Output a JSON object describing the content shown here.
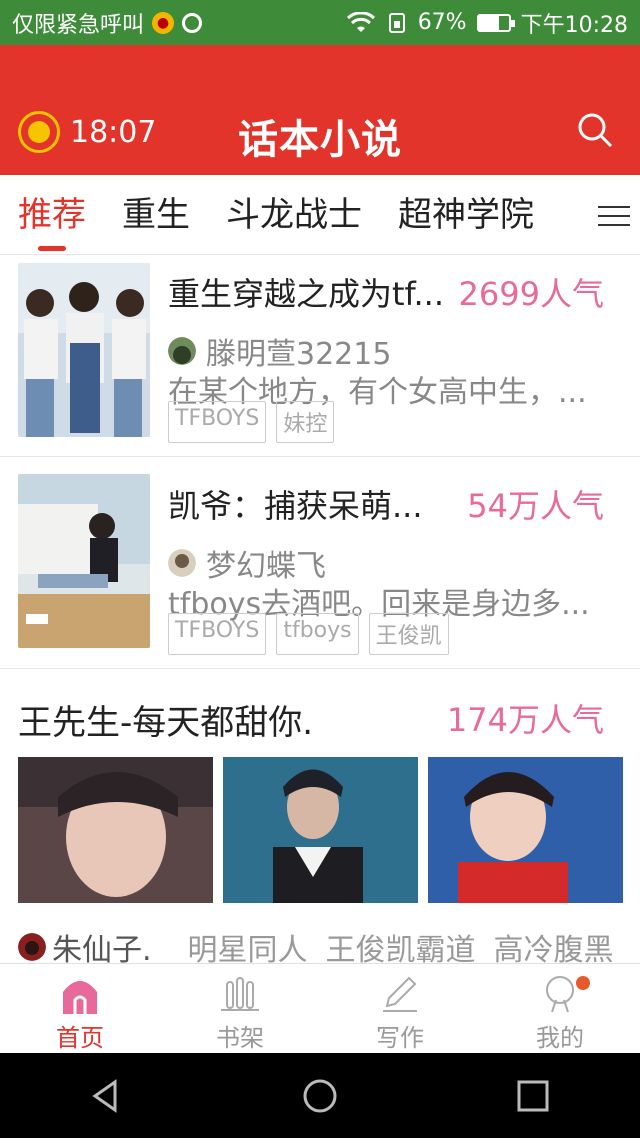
{
  "status_bar": {
    "carrier": "仅限紧急呼叫",
    "battery": "67%",
    "battery_level": 0.67,
    "time": "下午10:28"
  },
  "header": {
    "countdown": "18:07",
    "title": "话本小说"
  },
  "tabs": [
    {
      "label": "推荐",
      "active": true
    },
    {
      "label": "重生",
      "active": false
    },
    {
      "label": "斗龙战士",
      "active": false
    },
    {
      "label": "超神学院",
      "active": false
    }
  ],
  "books": [
    {
      "title": "重生穿越之成为tf...",
      "popularity": "2699人气",
      "author": "滕明萱32215",
      "description": "在某个地方，有个女高中生，...",
      "tags": [
        "TFBOYS",
        "妹控"
      ]
    },
    {
      "title": "凯爷：捕获呆萌...",
      "popularity": "54万人气",
      "author": "梦幻蝶飞",
      "description": "tfboys去酒吧。回来是身边多...",
      "tags": [
        "TFBOYS",
        "tfboys",
        "王俊凯"
      ]
    }
  ],
  "featured": {
    "title": "王先生-每天都甜你.",
    "popularity": "174万人气",
    "author": "朱仙子.",
    "tags": [
      "明星同人",
      "王俊凯霸道",
      "高冷腹黑"
    ]
  },
  "bottom_nav": [
    {
      "label": "首页",
      "active": true
    },
    {
      "label": "书架",
      "active": false
    },
    {
      "label": "写作",
      "active": false
    },
    {
      "label": "我的",
      "active": false
    }
  ],
  "colors": {
    "accent": "#e3342c",
    "popularity": "#e86a9a",
    "status_bar": "#3e8c3a"
  }
}
